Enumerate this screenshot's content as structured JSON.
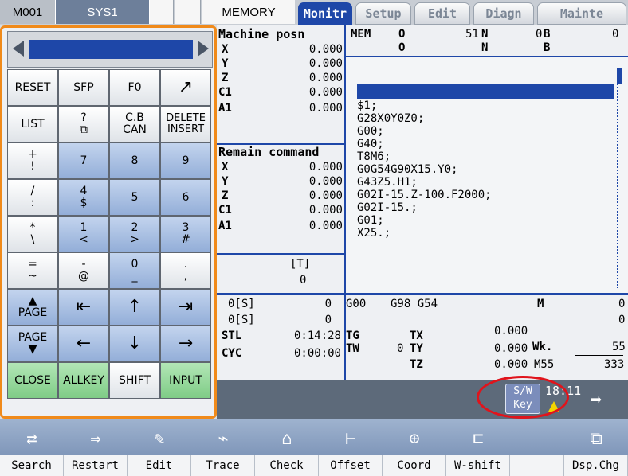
{
  "top": {
    "program": "M001",
    "system": "SYS1",
    "tabs": [
      "MEMORY",
      "Monitr",
      "Setup",
      "Edit",
      "Diagn",
      "Mainte"
    ]
  },
  "keypad": {
    "rows": [
      [
        "RESET",
        "SFP",
        "F0",
        "↗"
      ],
      [
        "LIST",
        "?\n⧉",
        "C.B\nCAN",
        "DELETE\nINSERT"
      ],
      [
        "+\n!",
        "7",
        "8",
        "9"
      ],
      [
        "/\n:",
        "4\n$",
        "5",
        "6"
      ],
      [
        "*\n\\",
        "1\n<",
        "2\n>",
        "3\n#"
      ],
      [
        "=\n~",
        "-\n@",
        "0\n_",
        ".\n,"
      ],
      [
        "▲\nPAGE",
        "⇤",
        "↑",
        "⇥"
      ],
      [
        "PAGE\n▼",
        "←",
        "↓",
        "→"
      ],
      [
        "CLOSE",
        "ALLKEY",
        "SHIFT",
        "INPUT"
      ]
    ]
  },
  "machine": {
    "title": "Machine posn",
    "axes": [
      "X",
      "Y",
      "Z",
      "C1",
      "A1"
    ],
    "values": [
      "0.000",
      "0.000",
      "0.000",
      "0.000",
      "0.000"
    ]
  },
  "remain": {
    "title": "Remain command",
    "axes": [
      "X",
      "Y",
      "Z",
      "C1",
      "A1"
    ],
    "values": [
      "0.000",
      "0.000",
      "0.000",
      "0.000",
      "0.000"
    ]
  },
  "tool": {
    "label": "[T]",
    "value": "0"
  },
  "spindle": {
    "rows": [
      {
        "label": "0[S]",
        "value": "0"
      },
      {
        "label": "0[S]",
        "value": "0"
      }
    ],
    "stl_label": "STL",
    "stl_value": "0:14:28",
    "cyc_label": "CYC",
    "cyc_value": "0:00:00"
  },
  "status": {
    "mode": "MEM",
    "o1": "O",
    "n1": "N",
    "b1": "B",
    "prog_num": "51",
    "b_val": "0",
    "right_val": "0"
  },
  "program_lines": [
    "$1;",
    "G28X0Y0Z0;",
    "G00;",
    "G40;",
    "T8M6;",
    "G0G54G90X15.Y0;",
    "G43Z5.H1;",
    "G02I-15.Z-100.F2000;",
    "G02I-15.;",
    "G01;",
    "X25.;"
  ],
  "modal": {
    "g1": "G00",
    "g2": "G98 G54",
    "tg": "TG",
    "tw": "TW",
    "tw_val": "0",
    "tx": "TX",
    "ty": "TY",
    "tz": "TZ",
    "tx_val": "0.000",
    "ty_val": "0.000",
    "tz_val": "0.000",
    "m": "M",
    "m_val1": "0",
    "m_val2": "0",
    "wk": "Wk.",
    "wk_val": "55",
    "m55": "M55",
    "m55_val": "333"
  },
  "swkey": {
    "line1": "S/W",
    "line2": "Key",
    "time": "18:11"
  },
  "softkeys": [
    "Search",
    "Restart",
    "Edit",
    "Trace",
    "Check",
    "Offset",
    "Coord",
    "W-shift",
    "",
    "Dsp.Chg"
  ],
  "colors": {
    "accent": "#1e47a8",
    "highlight": "#f08a1a",
    "alarm": "#e0141c"
  }
}
